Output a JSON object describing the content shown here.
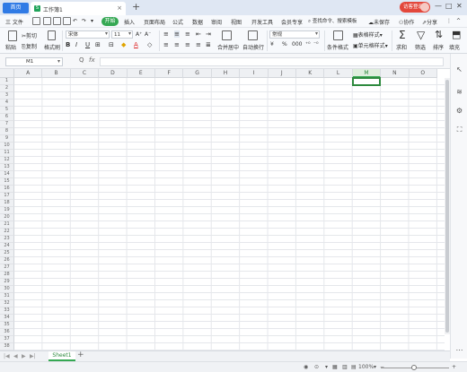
{
  "titlebar": {
    "home_tab": "首页",
    "doc_tab": "工作簿1",
    "doc_icon": "S",
    "close_glyph": "×",
    "add_tab": "+",
    "login_button": "访客登录"
  },
  "menu": {
    "file": "三 文件",
    "items": [
      "开始",
      "插入",
      "页面布局",
      "公式",
      "数据",
      "审阅",
      "视图",
      "开发工具",
      "会员专享"
    ],
    "search": "查找命令、搜索模板",
    "unsaved": "未保存",
    "collab": "协作",
    "share": "分享"
  },
  "toolbar": {
    "paste": "粘贴",
    "cut": "剪切",
    "copy": "复制",
    "format_painter": "格式刷",
    "font_name": "宋体",
    "font_size": "11",
    "bold": "B",
    "italic": "I",
    "underline": "U",
    "font_color": "A",
    "merge_center": "合并居中",
    "wrap_text": "自动换行",
    "number_format": "常规",
    "currency": "¥",
    "percent": "%",
    "conditional_format": "条件格式",
    "table_style": "表格样式",
    "cell_style": "单元格样式",
    "sum": "求和",
    "filter": "筛选",
    "sort": "排序",
    "fill": "填充"
  },
  "formula_bar": {
    "name_box": "M1",
    "fx": "fx",
    "zoom_glyph": "Q"
  },
  "grid": {
    "columns": [
      "A",
      "B",
      "C",
      "D",
      "E",
      "F",
      "G",
      "H",
      "I",
      "J",
      "K",
      "L",
      "M",
      "N",
      "O"
    ],
    "rows": [
      "1",
      "2",
      "3",
      "4",
      "5",
      "6",
      "7",
      "8",
      "9",
      "10",
      "11",
      "12",
      "13",
      "14",
      "15",
      "16",
      "17",
      "18",
      "19",
      "20",
      "21",
      "22",
      "23",
      "24",
      "25",
      "26",
      "27",
      "28",
      "29",
      "30",
      "31",
      "32",
      "33",
      "34",
      "35",
      "36",
      "37",
      "38"
    ],
    "selected_column": "M"
  },
  "sheets": {
    "tabs": [
      "Sheet1"
    ],
    "add": "+"
  },
  "status": {
    "zoom": "100%",
    "zoom_minus": "−",
    "zoom_plus": "+"
  },
  "colors": {
    "accent_green": "#35a853",
    "home_blue": "#2f7ae5",
    "login_red": "#e3473b"
  }
}
